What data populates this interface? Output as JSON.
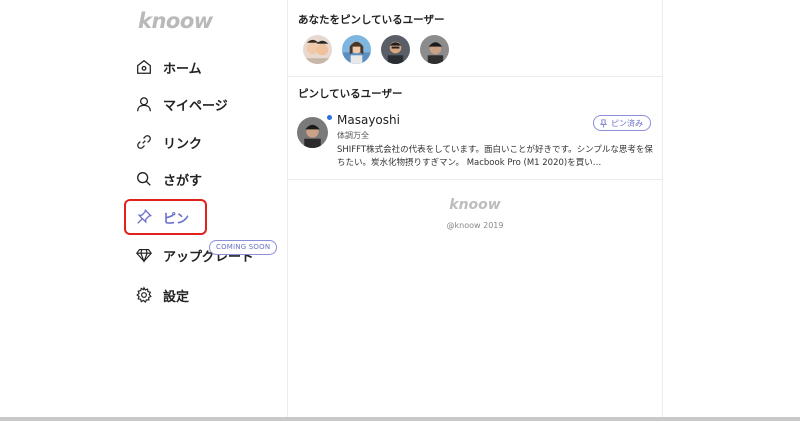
{
  "sidebar": {
    "logo": "knoow",
    "items": [
      {
        "label": "ホーム",
        "icon": "home-icon"
      },
      {
        "label": "マイページ",
        "icon": "user-icon"
      },
      {
        "label": "リンク",
        "icon": "link-icon"
      },
      {
        "label": "さがす",
        "icon": "search-icon"
      },
      {
        "label": "ピン",
        "icon": "pin-icon",
        "active": true
      },
      {
        "label": "アップグレード",
        "icon": "diamond-icon",
        "badge": "COMING SOON"
      },
      {
        "label": "設定",
        "icon": "gear-icon"
      }
    ],
    "active_color": "#6a70c9",
    "highlight_color": "#e0211d"
  },
  "main": {
    "pinned_by_title": "あなたをピンしているユーザー",
    "pinning_title": "ピンしているユーザー",
    "user": {
      "name": "Masayoshi",
      "subtitle": "体調万全",
      "bio": "SHIFFT株式会社の代表をしています。面白いことが好きです。シンプルな思考を保ちたい。炭水化物摂りすぎマン。 Macbook Pro (M1 2020)を買い…",
      "pin_button": "ピン済み",
      "online": true
    },
    "footer": {
      "logo": "knoow",
      "copyright": "@knoow 2019"
    }
  }
}
